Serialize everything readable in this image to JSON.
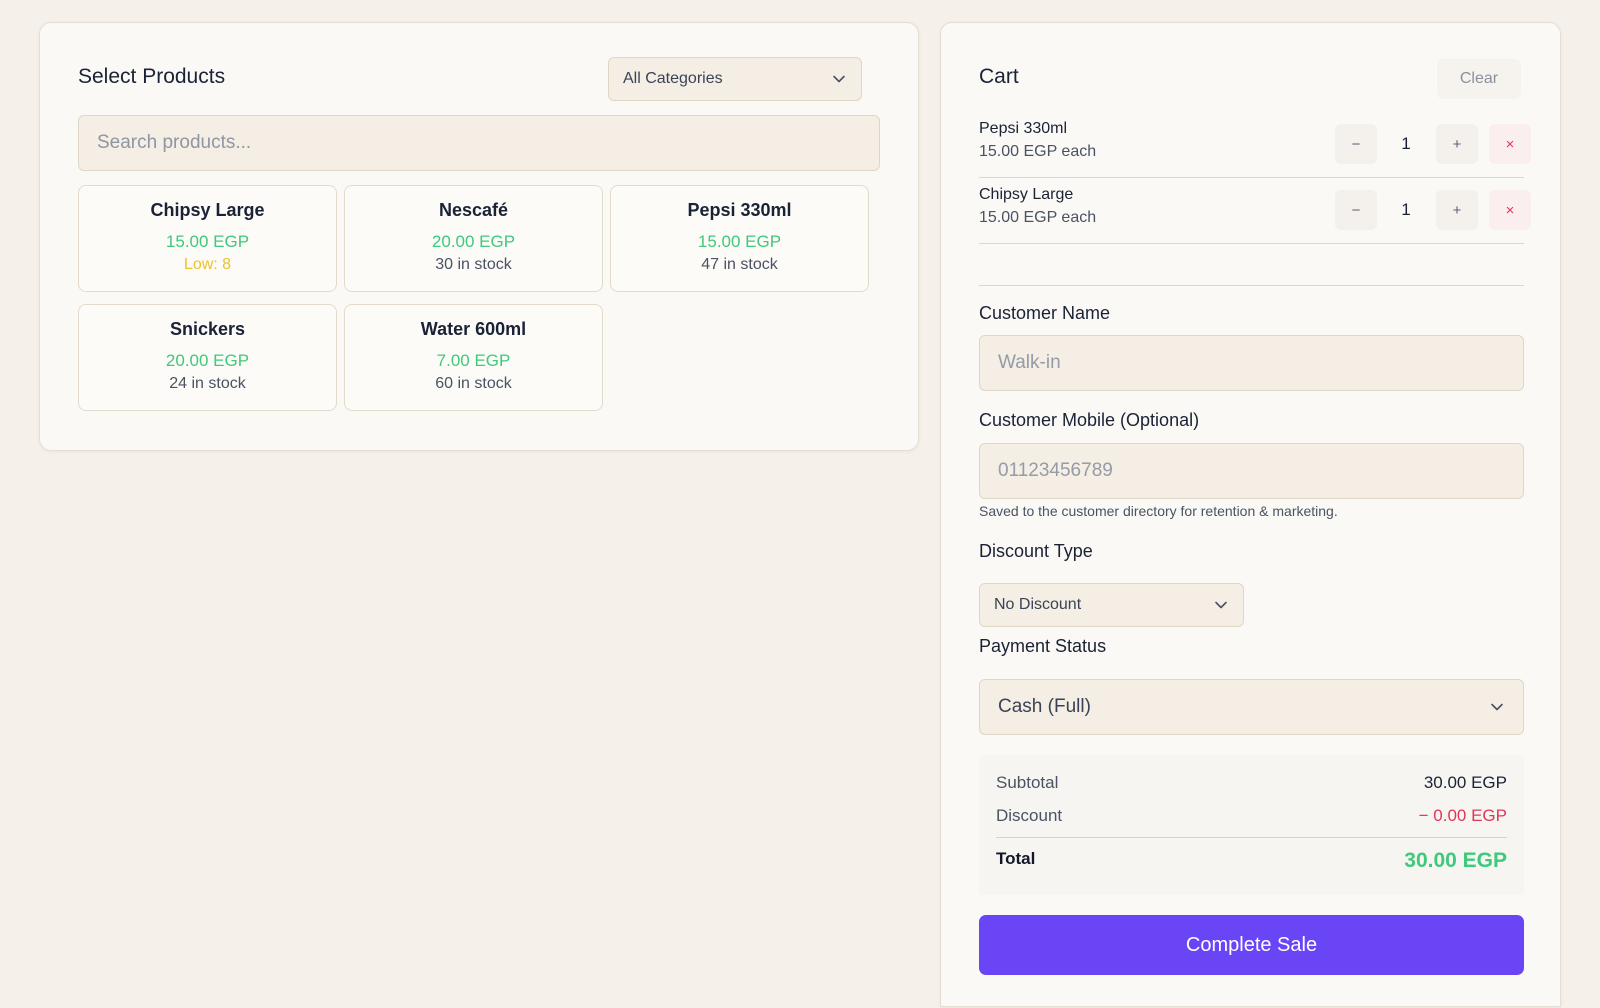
{
  "products_panel": {
    "title": "Select Products",
    "category_select": {
      "value": "All Categories",
      "icon": "chevron-down-icon"
    },
    "search": {
      "placeholder": "Search products..."
    },
    "products": [
      {
        "name": "Chipsy Large",
        "price": "15.00 EGP",
        "stock": "Low: 8",
        "low": true
      },
      {
        "name": "Nescafé",
        "price": "20.00 EGP",
        "stock": "30 in stock",
        "low": false
      },
      {
        "name": "Pepsi 330ml",
        "price": "15.00 EGP",
        "stock": "47 in stock",
        "low": false
      },
      {
        "name": "Snickers",
        "price": "20.00 EGP",
        "stock": "24 in stock",
        "low": false
      },
      {
        "name": "Water 600ml",
        "price": "7.00 EGP",
        "stock": "60 in stock",
        "low": false
      }
    ]
  },
  "cart": {
    "title": "Cart",
    "clear_label": "Clear",
    "items": [
      {
        "name": "Pepsi 330ml",
        "unit_price": "15.00 EGP each",
        "qty": "1"
      },
      {
        "name": "Chipsy Large",
        "unit_price": "15.00 EGP each",
        "qty": "1"
      }
    ],
    "buttons": {
      "decrement": "−",
      "increment": "+",
      "remove": "×"
    },
    "customer_name": {
      "label": "Customer Name",
      "placeholder": "Walk-in"
    },
    "customer_mobile": {
      "label": "Customer Mobile (Optional)",
      "placeholder": "01123456789",
      "hint": "Saved to the customer directory for retention & marketing."
    },
    "discount_type": {
      "label": "Discount Type",
      "value": "No Discount"
    },
    "payment_status": {
      "label": "Payment Status",
      "value": "Cash (Full)"
    },
    "summary": {
      "subtotal_label": "Subtotal",
      "subtotal_value": "30.00 EGP",
      "discount_label": "Discount",
      "discount_value": "− 0.00 EGP",
      "total_label": "Total",
      "total_value": "30.00 EGP"
    },
    "complete_label": "Complete Sale"
  },
  "colors": {
    "accent": "#6a45f5",
    "price_green": "#3fc97a",
    "low_stock_yellow": "#e9c32c",
    "danger_red": "#e0365a",
    "background": "#f5f0e9"
  }
}
